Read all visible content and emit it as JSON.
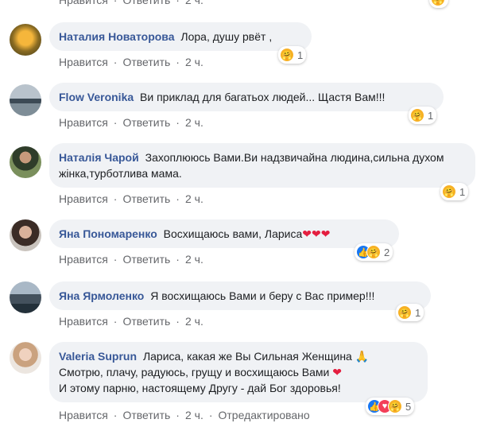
{
  "top_partial": {
    "like": "Нравится",
    "reply": "Ответить",
    "time": "2 ч."
  },
  "comments": [
    {
      "author": "Наталия Новаторова",
      "text": "Лора, душу рвёт ,",
      "like": "Нравится",
      "reply": "Ответить",
      "time": "2 ч.",
      "reactions": [
        "care-emoji"
      ],
      "count": "1"
    },
    {
      "author": "Flow Veronika",
      "text": "Ви приклад для багатьох людей... Щастя Вам!!!",
      "like": "Нравится",
      "reply": "Ответить",
      "time": "2 ч.",
      "reactions": [
        "care-emoji"
      ],
      "count": "1"
    },
    {
      "author": "Наталія Чарой",
      "text": "Захоплююсь Вами.Ви надзвичайна людина,сильна духом жінка,турботлива мама.",
      "like": "Нравится",
      "reply": "Ответить",
      "time": "2 ч.",
      "reactions": [
        "care-emoji"
      ],
      "count": "1"
    },
    {
      "author": "Яна Пономаренко",
      "text": "Восхищаюсь вами, Лариса",
      "hearts": "❤❤❤",
      "like": "Нравится",
      "reply": "Ответить",
      "time": "2 ч.",
      "reactions": [
        "like-emoji",
        "care-emoji"
      ],
      "count": "2"
    },
    {
      "author": "Яна Ярмоленко",
      "text": "Я восхищаюсь Вами и беру с Вас пример!!!",
      "like": "Нравится",
      "reply": "Ответить",
      "time": "2 ч.",
      "reactions": [
        "care-emoji"
      ],
      "count": "1"
    },
    {
      "author": "Valeria Suprun",
      "line1": "Лариса, какая же Вы Сильная Женщина",
      "pray": "🙏",
      "line2": "Смотрю, плачу, радуюсь, грущу и восхищаюсь Вами",
      "heart": "❤",
      "line3": "И этому парню, настоящему Другу - дай Бог здоровья!",
      "like": "Нравится",
      "reply": "Ответить",
      "time": "2 ч.",
      "edited": "Отредактировано",
      "reactions": [
        "like-emoji",
        "love-emoji",
        "care-emoji"
      ],
      "count": "5"
    }
  ],
  "colors": {
    "author": "#385898",
    "bubble": "#f0f2f5",
    "meta": "#65676b",
    "like": "#1877f2",
    "love": "#f33e58",
    "care": "#f7b125"
  }
}
